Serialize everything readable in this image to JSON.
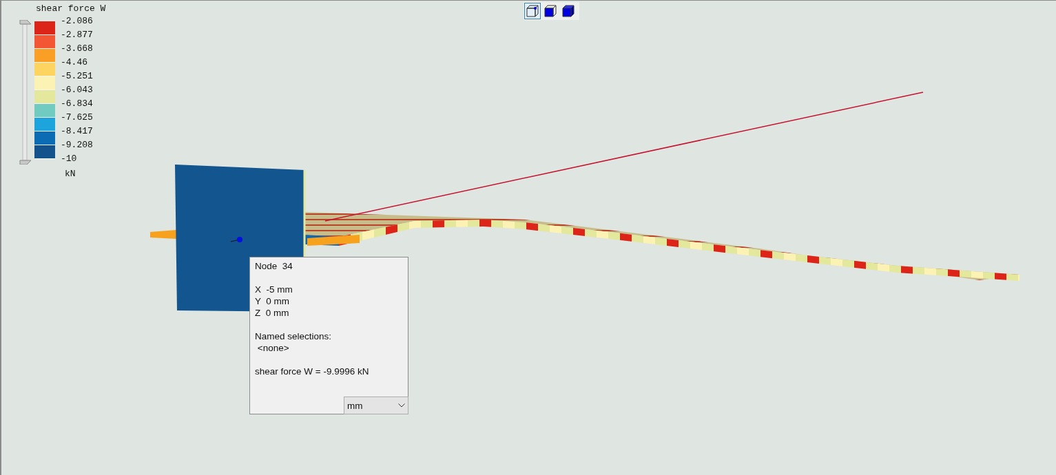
{
  "legend": {
    "title": "shear force W",
    "unit": "kN",
    "ticks": [
      "-2.086",
      "-2.877",
      "-3.668",
      "-4.46",
      "-5.251",
      "-6.043",
      "-6.834",
      "-7.625",
      "-8.417",
      "-9.208",
      "-10"
    ],
    "bands": [
      {
        "color": "#dd2419"
      },
      {
        "color": "#f25635"
      },
      {
        "color": "#f99f26"
      },
      {
        "color": "#fdd460"
      },
      {
        "color": "#fbf2b4"
      },
      {
        "color": "#e4e89c"
      },
      {
        "color": "#72cbc0"
      },
      {
        "color": "#1ea4dc"
      },
      {
        "color": "#0b6cb3"
      },
      {
        "color": "#13528b"
      }
    ]
  },
  "view_buttons": [
    {
      "kind": "wireframe",
      "selected": true
    },
    {
      "kind": "edges",
      "selected": false
    },
    {
      "kind": "shaded",
      "selected": false
    }
  ],
  "node_info": {
    "title": "Node  34",
    "coords": [
      "X  -5 mm",
      "Y  0 mm",
      "Z  0 mm"
    ],
    "selections_label": "Named selections:",
    "selections": "<none>",
    "result": "shear force W = -9.9996 kN",
    "unit": "mm"
  }
}
